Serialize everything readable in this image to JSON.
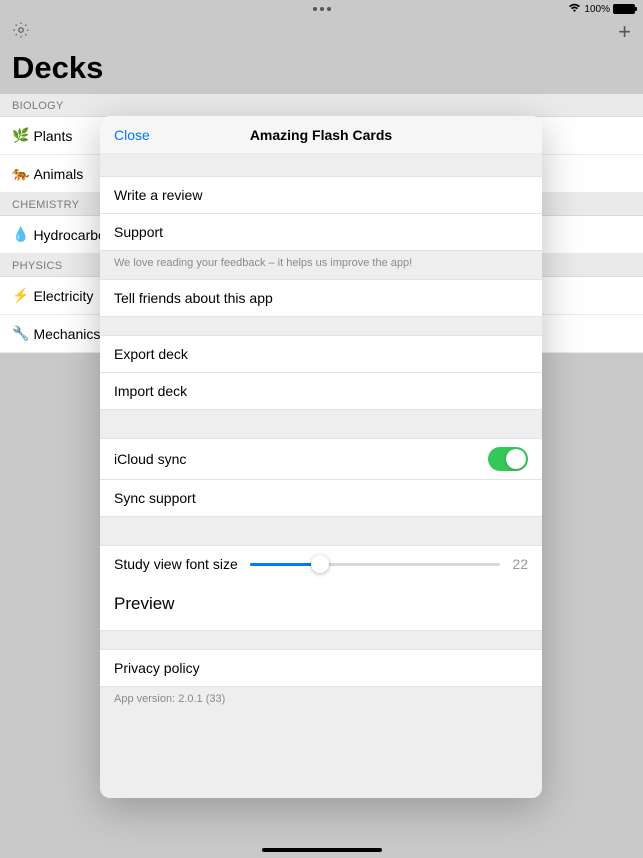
{
  "status": {
    "battery": "100%"
  },
  "header": {
    "title": "Decks"
  },
  "sections": [
    {
      "name": "BIOLOGY",
      "decks": [
        {
          "emoji": "🌿",
          "name": "Plants"
        },
        {
          "emoji": "🐅",
          "name": "Animals"
        }
      ]
    },
    {
      "name": "CHEMISTRY",
      "decks": [
        {
          "emoji": "💧",
          "name": "Hydrocarbons"
        }
      ]
    },
    {
      "name": "PHYSICS",
      "decks": [
        {
          "emoji": "⚡",
          "name": "Electricity"
        },
        {
          "emoji": "🔧",
          "name": "Mechanics"
        }
      ]
    }
  ],
  "modal": {
    "close": "Close",
    "title": "Amazing Flash Cards",
    "review": "Write a review",
    "support": "Support",
    "feedback_footer": "We love reading your feedback – it helps us improve the app!",
    "tell_friends": "Tell friends about this app",
    "export": "Export deck",
    "import": "Import deck",
    "icloud": "iCloud sync",
    "sync_support": "Sync support",
    "font_size_label": "Study view font size",
    "font_size_value": "22",
    "preview": "Preview",
    "privacy": "Privacy policy",
    "version": "App version: 2.0.1 (33)"
  }
}
